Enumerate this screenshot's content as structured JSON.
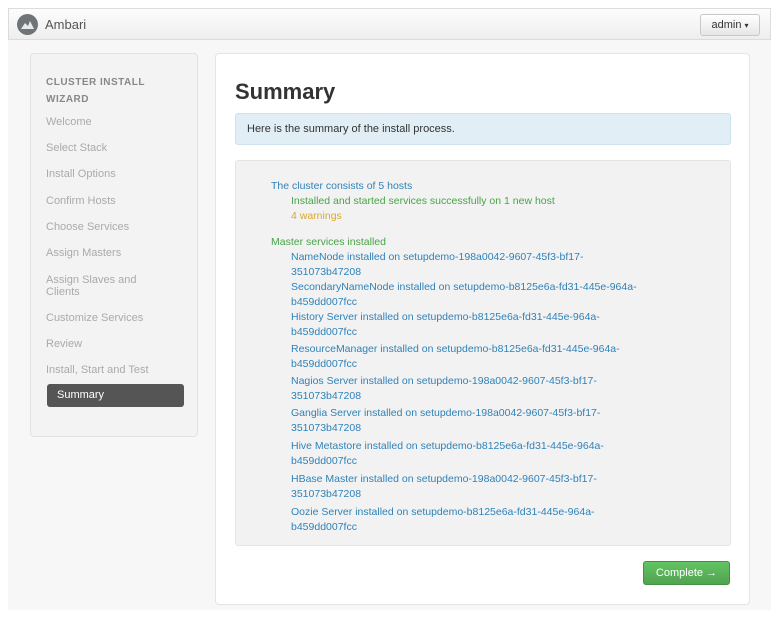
{
  "header": {
    "brand": "Ambari",
    "user_menu": "admin",
    "caret": "▾"
  },
  "sidebar": {
    "header": "CLUSTER INSTALL WIZARD",
    "items": [
      {
        "label": "Welcome"
      },
      {
        "label": "Select Stack"
      },
      {
        "label": "Install Options"
      },
      {
        "label": "Confirm Hosts"
      },
      {
        "label": "Choose Services"
      },
      {
        "label": "Assign Masters"
      },
      {
        "label": "Assign Slaves and Clients"
      },
      {
        "label": "Customize Services"
      },
      {
        "label": "Review"
      },
      {
        "label": "Install, Start and Test"
      },
      {
        "label": "Summary"
      }
    ]
  },
  "main": {
    "title": "Summary",
    "info": "Here is the summary of the install process.",
    "cluster_line": "The cluster consists of 5 hosts",
    "installed_line": "Installed and started services successfully on 1 new host",
    "warnings": "4 warnings",
    "master_header": "Master services installed",
    "services": [
      {
        "l1": "NameNode installed on setupdemo-198a0042-9607-45f3-bf17-",
        "l2": "351073b47208"
      },
      {
        "l1": "SecondaryNameNode installed on setupdemo-b8125e6a-fd31-445e-964a-",
        "l2": "b459dd007fcc"
      },
      {
        "l1": "History Server installed on setupdemo-b8125e6a-fd31-445e-964a-",
        "l2": "b459dd007fcc"
      },
      {
        "l1": "ResourceManager installed on setupdemo-b8125e6a-fd31-445e-964a-",
        "l2": "b459dd007fcc"
      },
      {
        "l1": "Nagios Server installed on setupdemo-198a0042-9607-45f3-bf17-",
        "l2": "351073b47208"
      },
      {
        "l1": "Ganglia Server installed on setupdemo-198a0042-9607-45f3-bf17-",
        "l2": "351073b47208"
      },
      {
        "l1": "Hive Metastore installed on setupdemo-b8125e6a-fd31-445e-964a-",
        "l2": "b459dd007fcc"
      },
      {
        "l1": "HBase Master installed on setupdemo-198a0042-9607-45f3-bf17-",
        "l2": "351073b47208"
      },
      {
        "l1": "Oozie Server installed on setupdemo-b8125e6a-fd31-445e-964a-",
        "l2": "b459dd007fcc"
      }
    ],
    "complete_button": "Complete →"
  }
}
